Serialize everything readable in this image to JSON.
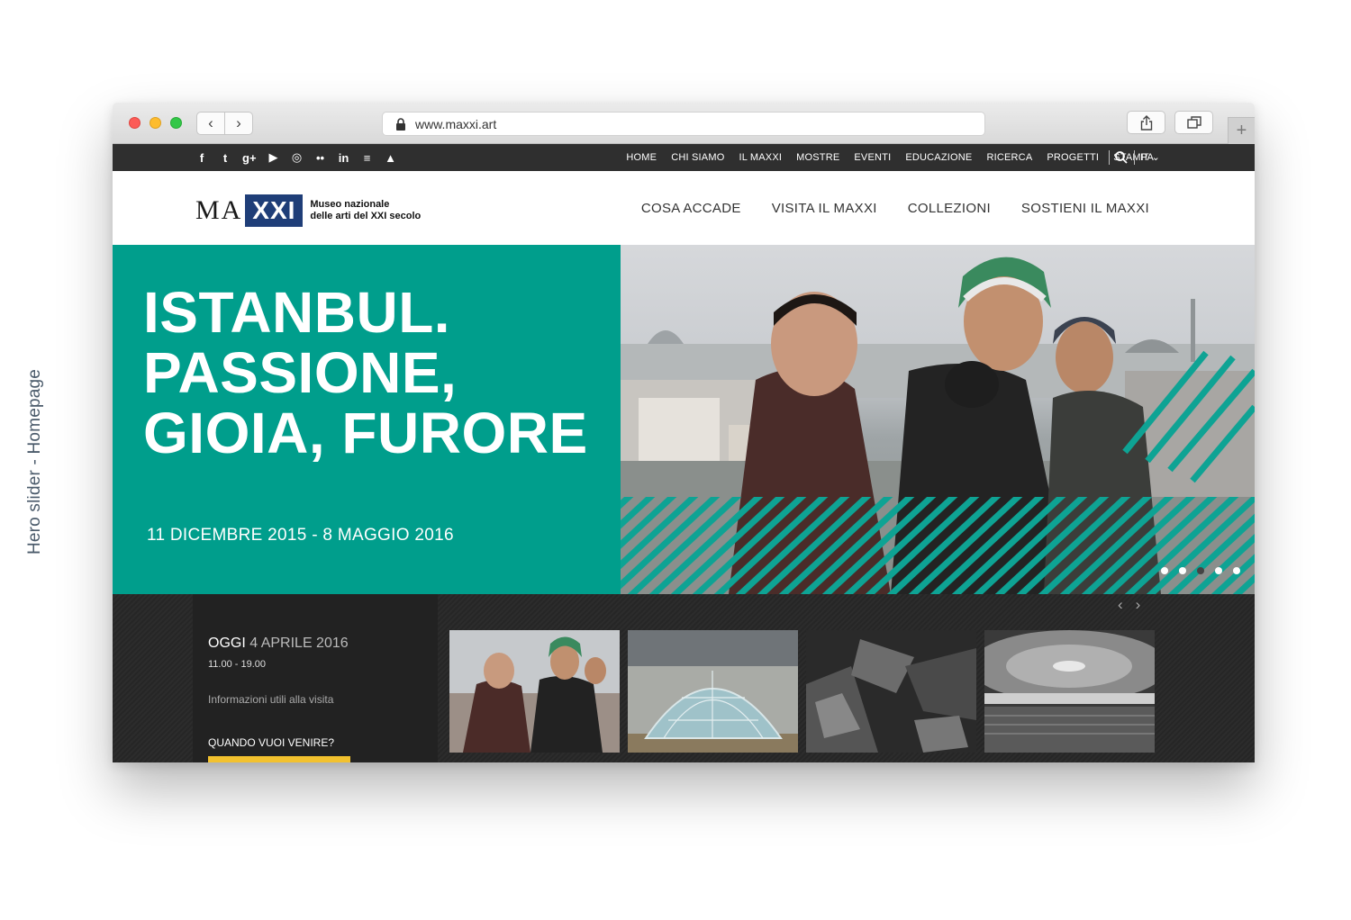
{
  "caption": "Hero slider - Homepage",
  "browser": {
    "url": "www.maxxi.art",
    "back_icon": "‹",
    "forward_icon": "›",
    "new_tab_icon": "+"
  },
  "topbar": {
    "social_icons": [
      "facebook-icon",
      "twitter-icon",
      "googleplus-icon",
      "youtube-icon",
      "instagram-icon",
      "flickr-icon",
      "linkedin-icon",
      "issuu-icon",
      "artsy-icon"
    ],
    "social_glyphs": [
      "f",
      "t",
      "g+",
      "▶",
      "◎",
      "••",
      "in",
      "≡",
      "▲"
    ],
    "nav": [
      "HOME",
      "CHI SIAMO",
      "IL MAXXI",
      "MOSTRE",
      "EVENTI",
      "EDUCAZIONE",
      "RICERCA",
      "PROGETTI",
      "STAMPA"
    ],
    "lang": "IT ⌄"
  },
  "header": {
    "logo_ma": "MA",
    "logo_xxi": "XXI",
    "logo_tag_1": "Museo nazionale",
    "logo_tag_2": "delle arti del XXI secolo",
    "nav": [
      "COSA ACCADE",
      "VISITA IL MAXXI",
      "COLLEZIONI",
      "SOSTIENI IL MAXXI"
    ]
  },
  "hero": {
    "title_1": "ISTANBUL.",
    "title_2": "PASSIONE,",
    "title_3": "GIOIA, FURORE",
    "date": "11 DICEMBRE 2015 - 8 MAGGIO 2016",
    "slides_total": 5,
    "active_slide": 3,
    "accent": "#009e8c"
  },
  "info": {
    "today_label": "OGGI",
    "today_date": "4 APRILE 2016",
    "hours": "11.00 - 19.00",
    "link": "Informazioni utili alla visita",
    "cta": "QUANDO VUOI VENIRE?",
    "cta_color": "#f2c12e"
  },
  "carousel": {
    "prev_icon": "‹",
    "next_icon": "›",
    "thumbs": [
      "thumb-istanbul",
      "thumb-glass-dome",
      "thumb-installation",
      "thumb-arena"
    ]
  }
}
